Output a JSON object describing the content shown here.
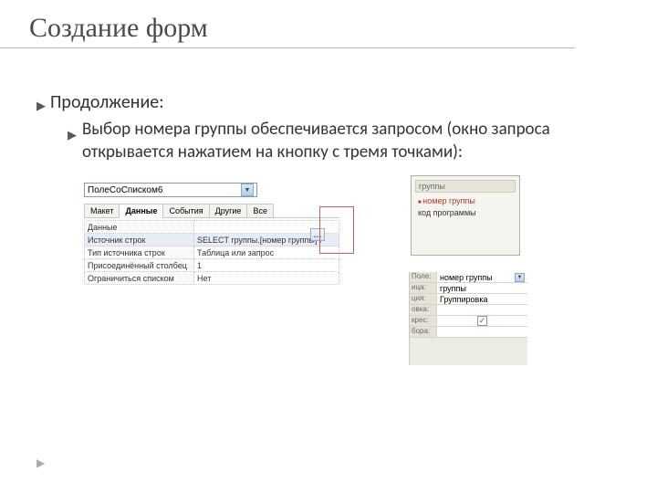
{
  "title": "Создание форм",
  "bullet1": "Продолжение:",
  "bullet2": "Выбор номера группы обеспечивается запросом (окно запроса открывается нажатием на кнопку с тремя точками):",
  "prop": {
    "combo": "ПолеСоСписком6",
    "tabs": {
      "t0": "Макет",
      "t1": "Данные",
      "t2": "События",
      "t3": "Другие",
      "t4": "Все"
    },
    "rows": {
      "r0l": "Данные",
      "r0v": "",
      "r1l": "Источник строк",
      "r1v": "SELECT группы.[номер группы] F",
      "r2l": "Тип источника строк",
      "r2v": "Таблица или запрос",
      "r3l": "Присоединённый столбец",
      "r3v": "1",
      "r4l": "Ограничиться списком",
      "r4v": "Нет"
    }
  },
  "tree": {
    "header": "группы",
    "i0": "номер группы",
    "i1": "код программы"
  },
  "qgrid": {
    "l0": "Поле:",
    "v0": "номер группы",
    "l1": "ица:",
    "v1": "группы",
    "l2": "ция:",
    "v2": "Группировка",
    "l3": "овка:",
    "l4": "крес:",
    "l5": "бора:"
  }
}
